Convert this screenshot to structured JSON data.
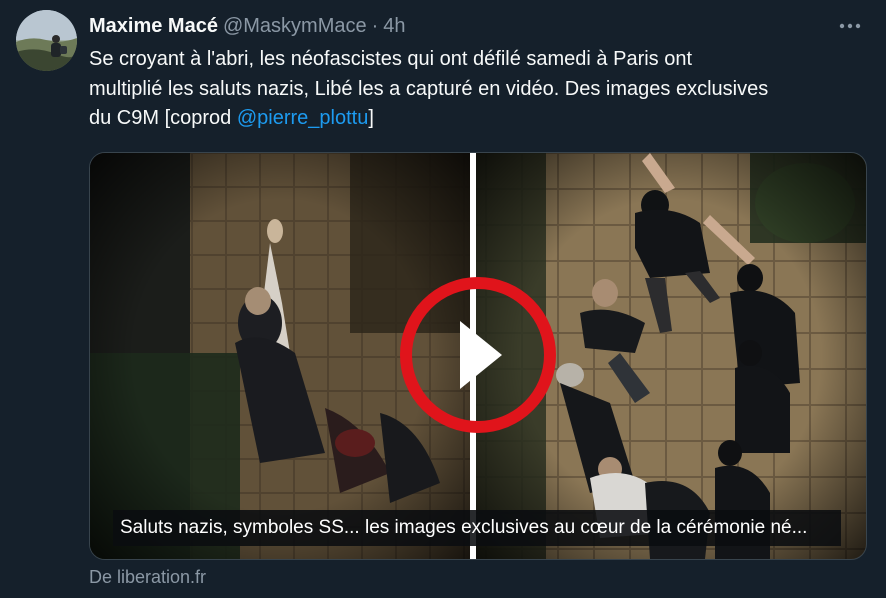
{
  "author": {
    "display_name": "Maxime Macé",
    "handle": "@MaskymMace",
    "separator": "·",
    "time": "4h"
  },
  "tweet": {
    "line1": "Se croyant à l'abri, les néofascistes qui ont défilé samedi à Paris ont",
    "line2": "multiplié les saluts nazis, Libé les a capturé en vidéo. Des images exclusives",
    "line3_prefix": "du C9M [coprod ",
    "mention": "@pierre_plottu",
    "line3_suffix": "]"
  },
  "card": {
    "title": "Saluts nazis, symboles SS... les images exclusives au cœur de la cérémonie né...",
    "source": "De liberation.fr"
  },
  "icons": {
    "more": "more-horizontal-icon",
    "play": "play-icon"
  },
  "colors": {
    "background": "#15202b",
    "link": "#1d9bf0",
    "secondary_text": "#8b98a5",
    "play_ring": "#e0141b"
  }
}
